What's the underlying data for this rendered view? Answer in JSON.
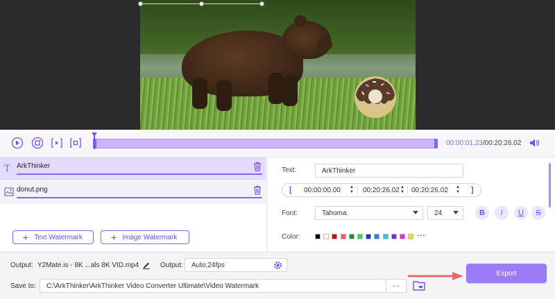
{
  "timeline": {
    "current_time": "00:00:01.23",
    "total_time": "/00:20:26.02"
  },
  "watermarks": [
    {
      "name": "ArkThinker",
      "type": "text"
    },
    {
      "name": "donut.png",
      "type": "image"
    }
  ],
  "buttons": {
    "text_watermark": "Text Watermark",
    "image_watermark": "Image Watermark",
    "export": "Export"
  },
  "editor": {
    "text_label": "Text:",
    "text_value": "ArkThinker",
    "start_time": "00:00:00.00",
    "end_time": "00:20:26.02",
    "duration": "00:20:26.02",
    "font_label": "Font:",
    "font_name": "Tahoma",
    "font_size": "24",
    "color_label": "Color:",
    "more_colors": "⋯",
    "style_buttons": [
      "B",
      "I",
      "U",
      "S"
    ],
    "colors": [
      "#000000",
      "#ffffff",
      "#c80000",
      "#ff4f7a",
      "#2b8a2b",
      "#3cd64c",
      "#1f2fc8",
      "#3a7bf2",
      "#2fc8d8",
      "#7a2ad2",
      "#e629e6",
      "#f2e600"
    ]
  },
  "bottom": {
    "output_label": "Output:",
    "output_file": "Y2Mate.is - 8K ...als  8K VID.mp4",
    "output2_label": "Output:",
    "output_format": "Auto;24fps",
    "save_label": "Save to:",
    "save_path": "C:\\ArkThinker\\ArkThinker Video Converter Ultimate\\Video Watermark",
    "browse": "···"
  },
  "colors": {
    "accent": "#7a4cf0",
    "export_bg": "#9b7cf7",
    "selected_row": "#e3dbfc"
  }
}
